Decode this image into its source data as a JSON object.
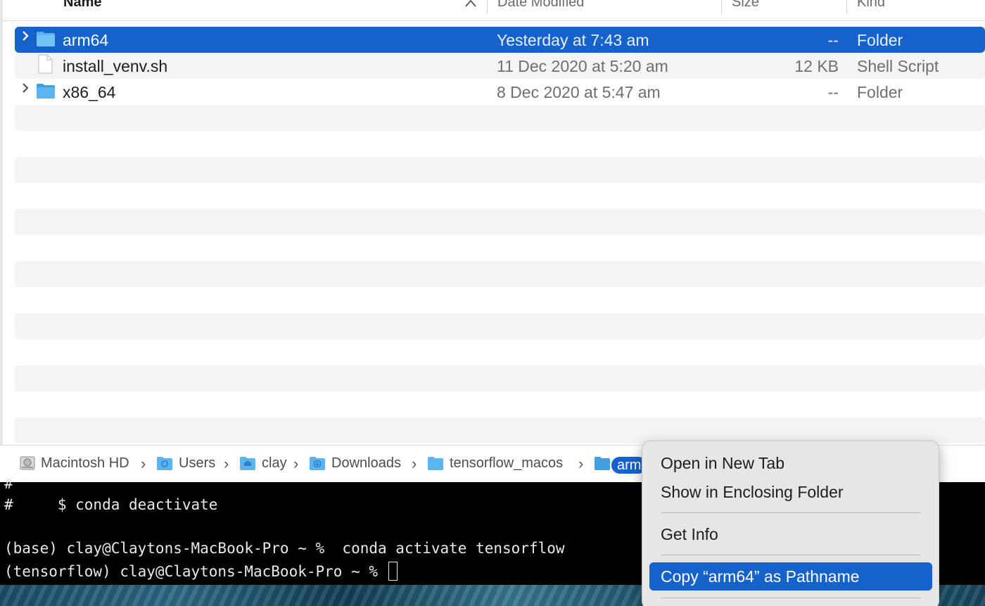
{
  "columns": {
    "name": "Name",
    "date": "Date Modified",
    "size": "Size",
    "kind": "Kind",
    "sort_indicator": "chevron-up-icon"
  },
  "files": [
    {
      "name": "arm64",
      "date": "Yesterday at 7:43 am",
      "size": "--",
      "kind": "Folder",
      "icon": "folder-icon",
      "selected": true,
      "expandable": true
    },
    {
      "name": "install_venv.sh",
      "date": "11 Dec 2020 at 5:20 am",
      "size": "12 KB",
      "kind": "Shell Script",
      "icon": "document-icon",
      "selected": false,
      "expandable": false
    },
    {
      "name": "x86_64",
      "date": "8 Dec 2020 at 5:47 am",
      "size": "--",
      "kind": "Folder",
      "icon": "folder-icon",
      "selected": false,
      "expandable": true
    }
  ],
  "pathbar": {
    "crumbs": [
      {
        "label": "Macintosh HD",
        "icon": "hard-drive-icon"
      },
      {
        "label": "Users",
        "icon": "users-folder-icon"
      },
      {
        "label": "clay",
        "icon": "home-folder-icon"
      },
      {
        "label": "Downloads",
        "icon": "downloads-folder-icon"
      },
      {
        "label": "tensorflow_macos",
        "icon": "folder-icon"
      }
    ],
    "current": "arm",
    "separator": "›"
  },
  "terminal": {
    "lines": [
      "#",
      "#     $ conda deactivate",
      "",
      "(base) clay@Claytons-MacBook-Pro ~ %  conda activate tensorflow",
      "(tensorflow) clay@Claytons-MacBook-Pro ~ % "
    ]
  },
  "context_menu": {
    "items": [
      {
        "label": "Open in New Tab"
      },
      {
        "label": "Show in Enclosing Folder"
      },
      {
        "label": "Get Info"
      },
      {
        "label": "Copy “arm64” as Pathname",
        "highlighted": true
      }
    ]
  },
  "colors": {
    "selection": "#1562cc",
    "folder": "#5ab4f0",
    "alt_row": "#f3f4f4"
  }
}
